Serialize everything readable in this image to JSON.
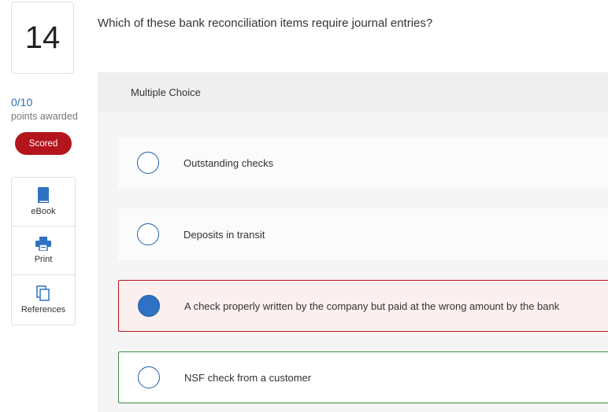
{
  "question": {
    "number": "14",
    "text": "Which of these bank reconciliation items require journal entries?"
  },
  "score": {
    "points": "0/10",
    "label": "points awarded",
    "badge": "Scored",
    "badge_color": "#b4151c"
  },
  "tools": [
    {
      "label": "eBook",
      "icon": "book-icon"
    },
    {
      "label": "Print",
      "icon": "printer-icon"
    },
    {
      "label": "References",
      "icon": "documents-icon"
    }
  ],
  "answer_panel": {
    "type_label": "Multiple Choice",
    "choices": [
      {
        "label": "Outstanding checks",
        "selected": false,
        "status": "neutral"
      },
      {
        "label": "Deposits in transit",
        "selected": false,
        "status": "neutral"
      },
      {
        "label": "A check properly written by the company but paid at the wrong amount by the bank",
        "selected": true,
        "status": "incorrect"
      },
      {
        "label": "NSF check from a customer",
        "selected": false,
        "status": "correct"
      }
    ]
  },
  "colors": {
    "accent_blue": "#2f72c4",
    "incorrect_border": "#b4151c",
    "correct_border": "#3f8a3f"
  }
}
